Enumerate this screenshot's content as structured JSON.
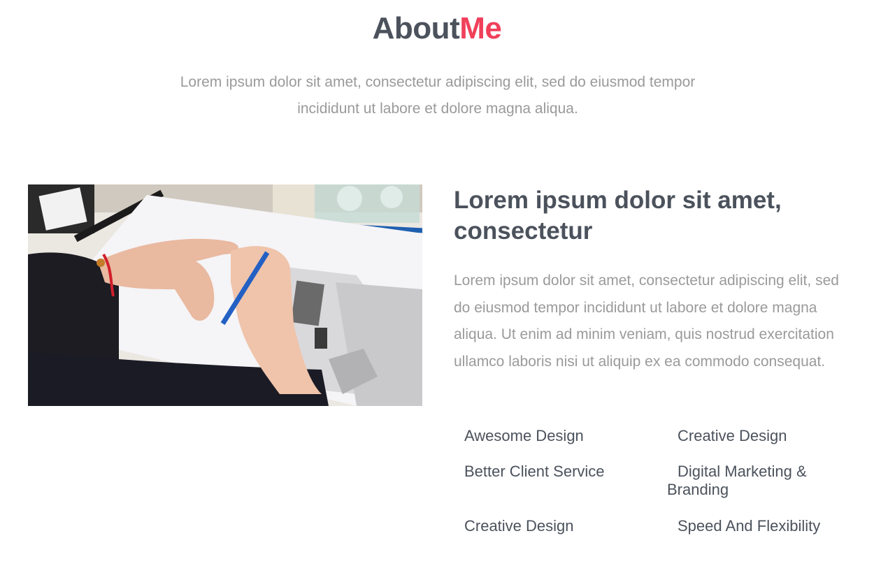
{
  "header": {
    "title_part1": "About",
    "title_part2": "Me",
    "intro": "Lorem ipsum dolor sit amet, consectetur adipiscing elit, sed do eiusmod tempor incididunt ut labore et dolore magna aliqua."
  },
  "colors": {
    "heading": "#4b525c",
    "accent": "#f0405a",
    "muted_text": "#9a9a9a"
  },
  "about": {
    "subtitle": "Lorem ipsum dolor sit amet, consectetur",
    "body": "Lorem ipsum dolor sit amet, consectetur adipiscing elit, sed do eiusmod tempor incididunt ut labore et dolore magna aliqua. Ut enim ad minim veniam, quis nostrud exercitation ullamco laboris nisi ut aliquip ex ea commodo consequat.",
    "features": [
      "Awesome Design",
      "Creative Design",
      "Better Client Service",
      "Digital Marketing & Branding",
      "Creative Design",
      "Speed And Flexibility"
    ]
  }
}
